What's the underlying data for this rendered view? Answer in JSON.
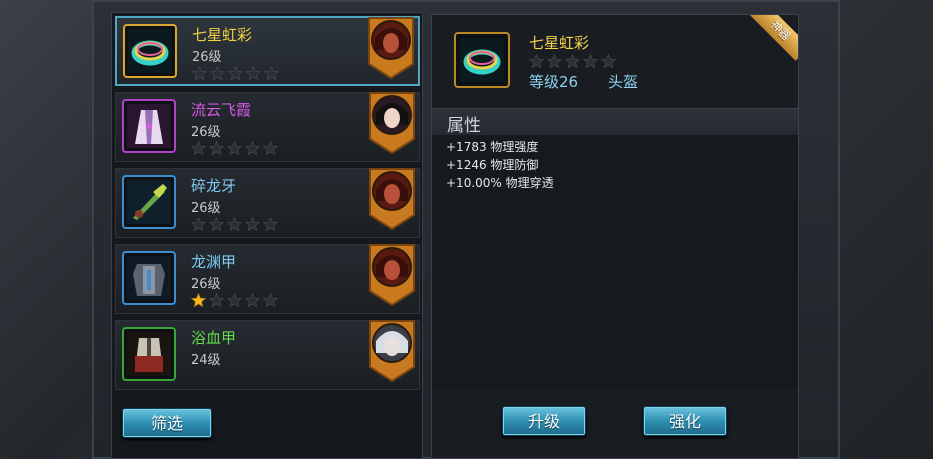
{
  "equipment_list": [
    {
      "name": "七星虹彩",
      "level": "26级",
      "stars": 0,
      "name_color": "#f2d243",
      "border": "#d9a72c",
      "icon": "rainbow-ring-icon",
      "hero": "red-hero-portrait-icon",
      "selected": true
    },
    {
      "name": "流云飞霞",
      "level": "26级",
      "stars": 0,
      "name_color": "#d65ae8",
      "border": "#b243c9",
      "icon": "robe-icon",
      "hero": "dark-haired-hero-portrait-icon",
      "selected": false
    },
    {
      "name": "碎龙牙",
      "level": "26级",
      "stars": 0,
      "name_color": "#7ec9ef",
      "border": "#3b8fd0",
      "icon": "dragon-blade-icon",
      "hero": "red-hero-portrait-icon",
      "selected": false
    },
    {
      "name": "龙渊甲",
      "level": "26级",
      "stars": 1,
      "name_color": "#7ec9ef",
      "border": "#3b8fd0",
      "icon": "armor-icon",
      "hero": "red-hero-portrait-icon",
      "selected": false
    },
    {
      "name": "浴血甲",
      "level": "24级",
      "stars": 0,
      "name_color": "#5fdb4d",
      "border": "#3aa637",
      "icon": "blood-armor-icon",
      "hero": "white-haired-hero-portrait-icon",
      "selected": false
    }
  ],
  "buttons": {
    "filter": "筛选",
    "upgrade": "升级",
    "enhance": "强化"
  },
  "detail": {
    "name": "七星虹彩",
    "level": "等级26",
    "slot": "头盔",
    "stars": 0,
    "ribbon": "神器",
    "attributes_header": "属性",
    "attributes": [
      "+1783 物理强度",
      "+1246 物理防御",
      "+10.00% 物理穿透"
    ]
  },
  "colors": {
    "accent_button": "#2e8fb2",
    "gold": "#d9a72c",
    "selection": "#4fa7c4"
  }
}
